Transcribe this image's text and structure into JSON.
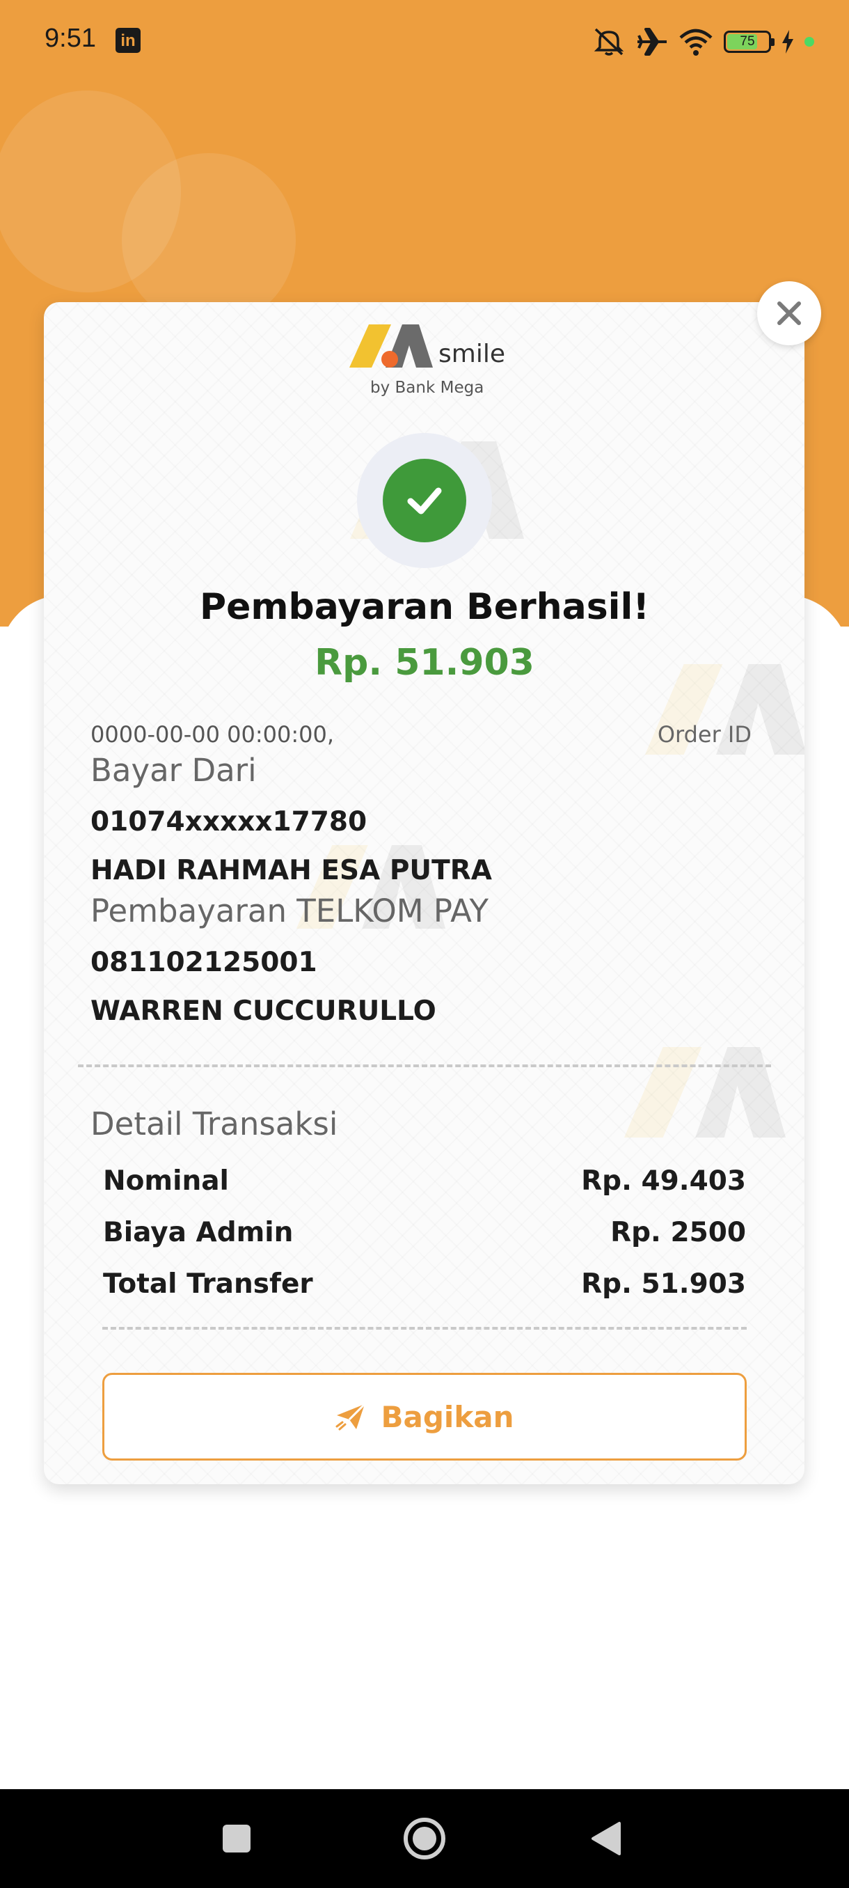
{
  "status_bar": {
    "time": "9:51",
    "battery": "75",
    "battery_level": 0.75,
    "icons": [
      "linkedin-icon",
      "mute-icon",
      "airplane-icon",
      "wifi-icon",
      "battery-icon",
      "charging-icon"
    ]
  },
  "colors": {
    "brand_orange": "#ed9e3f",
    "success_green": "#4a9a3e",
    "nav_black": "#000000"
  },
  "brand": {
    "name": "smile",
    "sub": "by Bank Mega"
  },
  "receipt": {
    "title": "Pembayaran Berhasil!",
    "amount": "Rp. 51.903",
    "date": "0000-00-00 00:00:00,",
    "order_id_label": "Order ID",
    "from_label": "Bayar Dari",
    "account_number": "01074xxxxx17780",
    "account_name": "HADI RAHMAH ESA PUTRA",
    "payment_label": "Pembayaran TELKOM PAY",
    "customer_number": "081102125001",
    "customer_name": "WARREN CUCCURULLO"
  },
  "details": {
    "title": "Detail Transaksi",
    "rows": [
      {
        "label": "Nominal",
        "value": "Rp. 49.403"
      },
      {
        "label": "Biaya Admin",
        "value": "Rp. 2500"
      },
      {
        "label": "Total Transfer",
        "value": "Rp. 51.903"
      }
    ]
  },
  "actions": {
    "share_label": "Bagikan"
  }
}
